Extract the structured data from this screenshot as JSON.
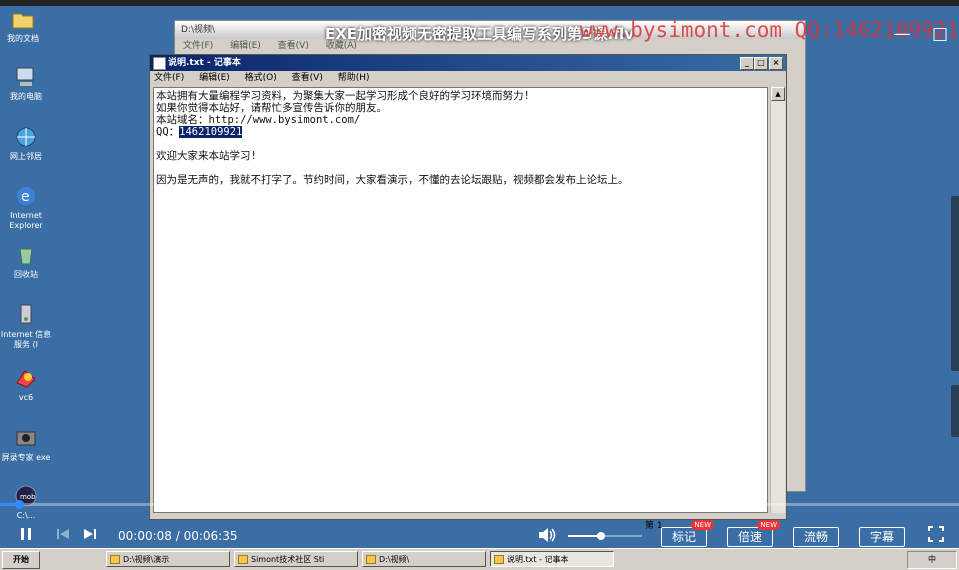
{
  "video": {
    "title": "EXE加密视频无密提取工具编写系列第3课.flv",
    "watermark": "www.bysimont.com  QQ:1462109921",
    "time_current": "00:00:08",
    "time_separator": " / ",
    "time_total": "00:06:35",
    "progress_fraction": 0.02,
    "volume_fraction": 0.45,
    "buttons": {
      "bookmark": "标记",
      "speed": "倍速",
      "quality": "流畅",
      "subtitle": "字幕"
    },
    "new_badge": "NEW"
  },
  "desktop_icons": [
    {
      "label": "我的文档",
      "icon": "folder-icon"
    },
    {
      "label": "我的电脑",
      "icon": "computer-icon"
    },
    {
      "label": "网上邻居",
      "icon": "network-icon"
    },
    {
      "label": "Internet Explorer",
      "icon": "ie-icon"
    },
    {
      "label": "回收站",
      "icon": "recycle-bin-icon"
    },
    {
      "label": "Internet 信息服务 (I",
      "icon": "iis-icon"
    },
    {
      "label": "vc6",
      "icon": "vc6-icon"
    },
    {
      "label": "屏录专家 exe",
      "icon": "recorder-icon"
    },
    {
      "label": "C:\\...",
      "icon": "app-icon"
    }
  ],
  "back_window": {
    "title": "D:\\视频\\",
    "menu": [
      "文件(F)",
      "编辑(E)",
      "查看(V)",
      "收藏(A)"
    ]
  },
  "notepad": {
    "title": "说明.txt - 记事本",
    "menu": [
      "文件(F)",
      "编辑(E)",
      "格式(O)",
      "查看(V)",
      "帮助(H)"
    ],
    "lines": [
      "本站拥有大量编程学习资料，为聚集大家一起学习形成个良好的学习环境而努力!",
      "如果你觉得本站好，请帮忙多宣传告诉你的朋友。",
      "本站域名：http://www.bysimont.com/"
    ],
    "qq_prefix": "QQ：",
    "qq_selected": "1462109921",
    "welcome": "欢迎大家来本站学习!",
    "note": "因为是无声的，我就不打字了。节约时间，大家看演示，不懂的去论坛跟贴，视频都会发布上论坛上。",
    "status": "第 1"
  },
  "taskbar": {
    "start": "开始",
    "tasks": [
      "D:\\视频\\演示",
      "Simont技术社区 Sti",
      "D:\\视频\\",
      "说明.txt - 记事本"
    ],
    "tray": "中"
  }
}
